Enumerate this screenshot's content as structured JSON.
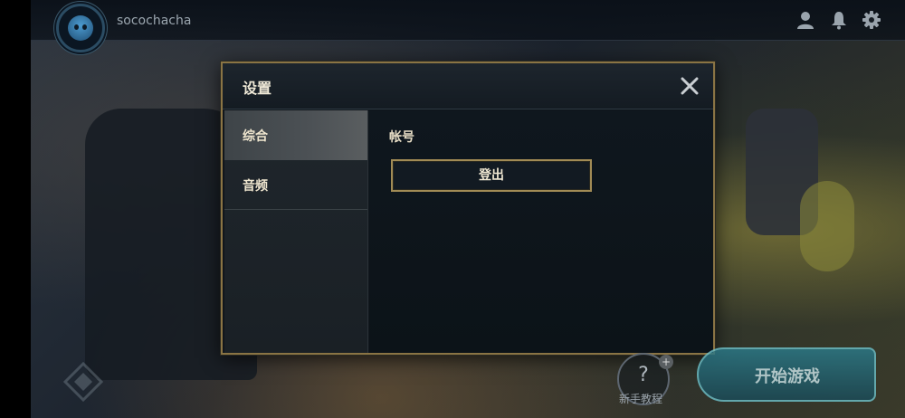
{
  "top_bar": {
    "username": "socochacha",
    "icons": [
      "profile-icon",
      "bell-icon",
      "gear-icon"
    ]
  },
  "modal": {
    "title": "设置",
    "sidebar": [
      {
        "label": "综合",
        "active": true
      },
      {
        "label": "音频",
        "active": false
      }
    ],
    "content": {
      "section_label": "帐号",
      "logout_label": "登出"
    }
  },
  "bottom": {
    "tutorial_icon": "?",
    "tutorial_plus": "+",
    "tutorial_label": "新手教程",
    "start_label": "开始游戏"
  },
  "colors": {
    "accent_gold": "#8a7444",
    "button_border": "#a18b55",
    "start_teal": "#2b7c8c"
  }
}
